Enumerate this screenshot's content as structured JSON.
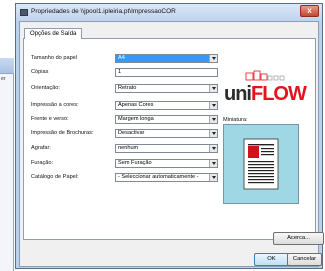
{
  "window": {
    "title": "Propriedades de \\\\jpool1.ipleiria.pt\\ImpressaoCOR",
    "close_glyph": "x"
  },
  "background_window": {
    "text": "er"
  },
  "tabs": [
    {
      "label": "Opções de Saída"
    }
  ],
  "form": {
    "rows": [
      {
        "label": "Tamanho do papel",
        "value": "A4",
        "type": "select",
        "highlighted": true
      },
      {
        "label": "Cópias",
        "value": "1",
        "type": "input",
        "highlighted": false
      },
      {
        "label": "Orientação:",
        "value": "Retrato",
        "type": "select",
        "highlighted": false
      },
      {
        "label": "Impressão a cores:",
        "value": "Apenas Cores",
        "type": "select",
        "highlighted": false
      },
      {
        "label": "Frente e verso:",
        "value": "Margem longa",
        "type": "select",
        "highlighted": false
      },
      {
        "label": "Impressão de Brochuras:",
        "value": "Desactivar",
        "type": "select",
        "highlighted": false
      },
      {
        "label": "Agrafar:",
        "value": "nenhum",
        "type": "select",
        "highlighted": false
      },
      {
        "label": "Furação:",
        "value": "Sem Furação",
        "type": "select",
        "highlighted": false
      },
      {
        "label": "Catálogo de Papel:",
        "value": "- Seleccionar automaticamente -",
        "type": "select",
        "highlighted": false
      }
    ]
  },
  "logo": {
    "part1": "uni",
    "part2": "FLOW"
  },
  "preview": {
    "label": "Miniatura:"
  },
  "buttons": {
    "about": "Acerca...",
    "ok": "OK",
    "cancel": "Cancelar"
  },
  "colors": {
    "accent_red": "#e3141c",
    "selection_blue": "#3399ff",
    "preview_bg": "#9fd7e4"
  }
}
